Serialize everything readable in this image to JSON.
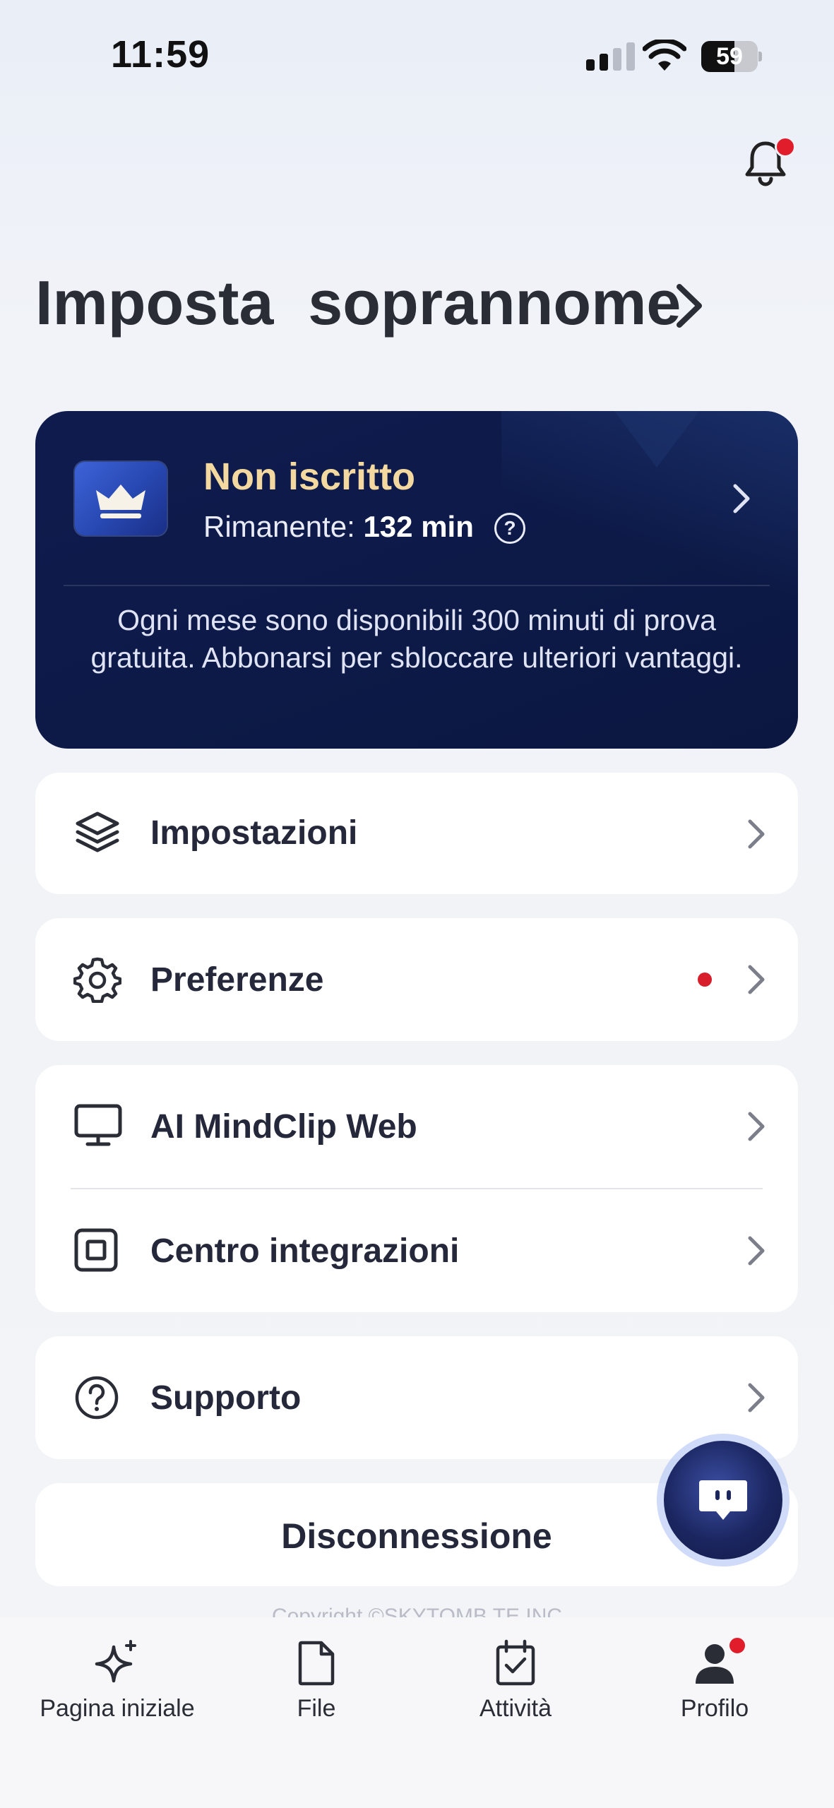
{
  "status_bar": {
    "time": "11:59",
    "battery": "59",
    "battery_level": 0.59
  },
  "header": {
    "title": "Imposta  soprannome"
  },
  "subscription": {
    "status": "Non iscritto",
    "remaining_label": "Rimanente: ",
    "remaining_value": "132 min",
    "help_icon": "?",
    "description": "Ogni mese sono disponibili 300 minuti di prova gratuita. Abbonarsi per sbloccare ulteriori vantaggi."
  },
  "menu": {
    "settings": {
      "label": "Impostazioni",
      "icon": "layers-icon"
    },
    "preferences": {
      "label": "Preferenze",
      "icon": "gear-icon",
      "has_badge": true
    },
    "web": {
      "label": "AI MindClip Web",
      "icon": "monitor-icon"
    },
    "integrations": {
      "label": "Centro integrazioni",
      "icon": "square-icon"
    },
    "support": {
      "label": "Supporto",
      "icon": "question-circle-icon"
    }
  },
  "logout": {
    "label": "Disconnessione"
  },
  "footer": {
    "copyright": "Copyright ©SKYTOMB TE INC"
  },
  "bottom_nav": {
    "home": {
      "label": "Pagina iniziale",
      "icon": "sparkle-icon"
    },
    "files": {
      "label": "File",
      "icon": "file-icon"
    },
    "tasks": {
      "label": "Attività",
      "icon": "calendar-check-icon"
    },
    "profile": {
      "label": "Profilo",
      "icon": "user-icon",
      "active": true
    }
  },
  "colors": {
    "card_dark": "#0f1b4d",
    "gold": "#f3d9a0",
    "badge_red": "#d81e2a",
    "text": "#25283a"
  }
}
